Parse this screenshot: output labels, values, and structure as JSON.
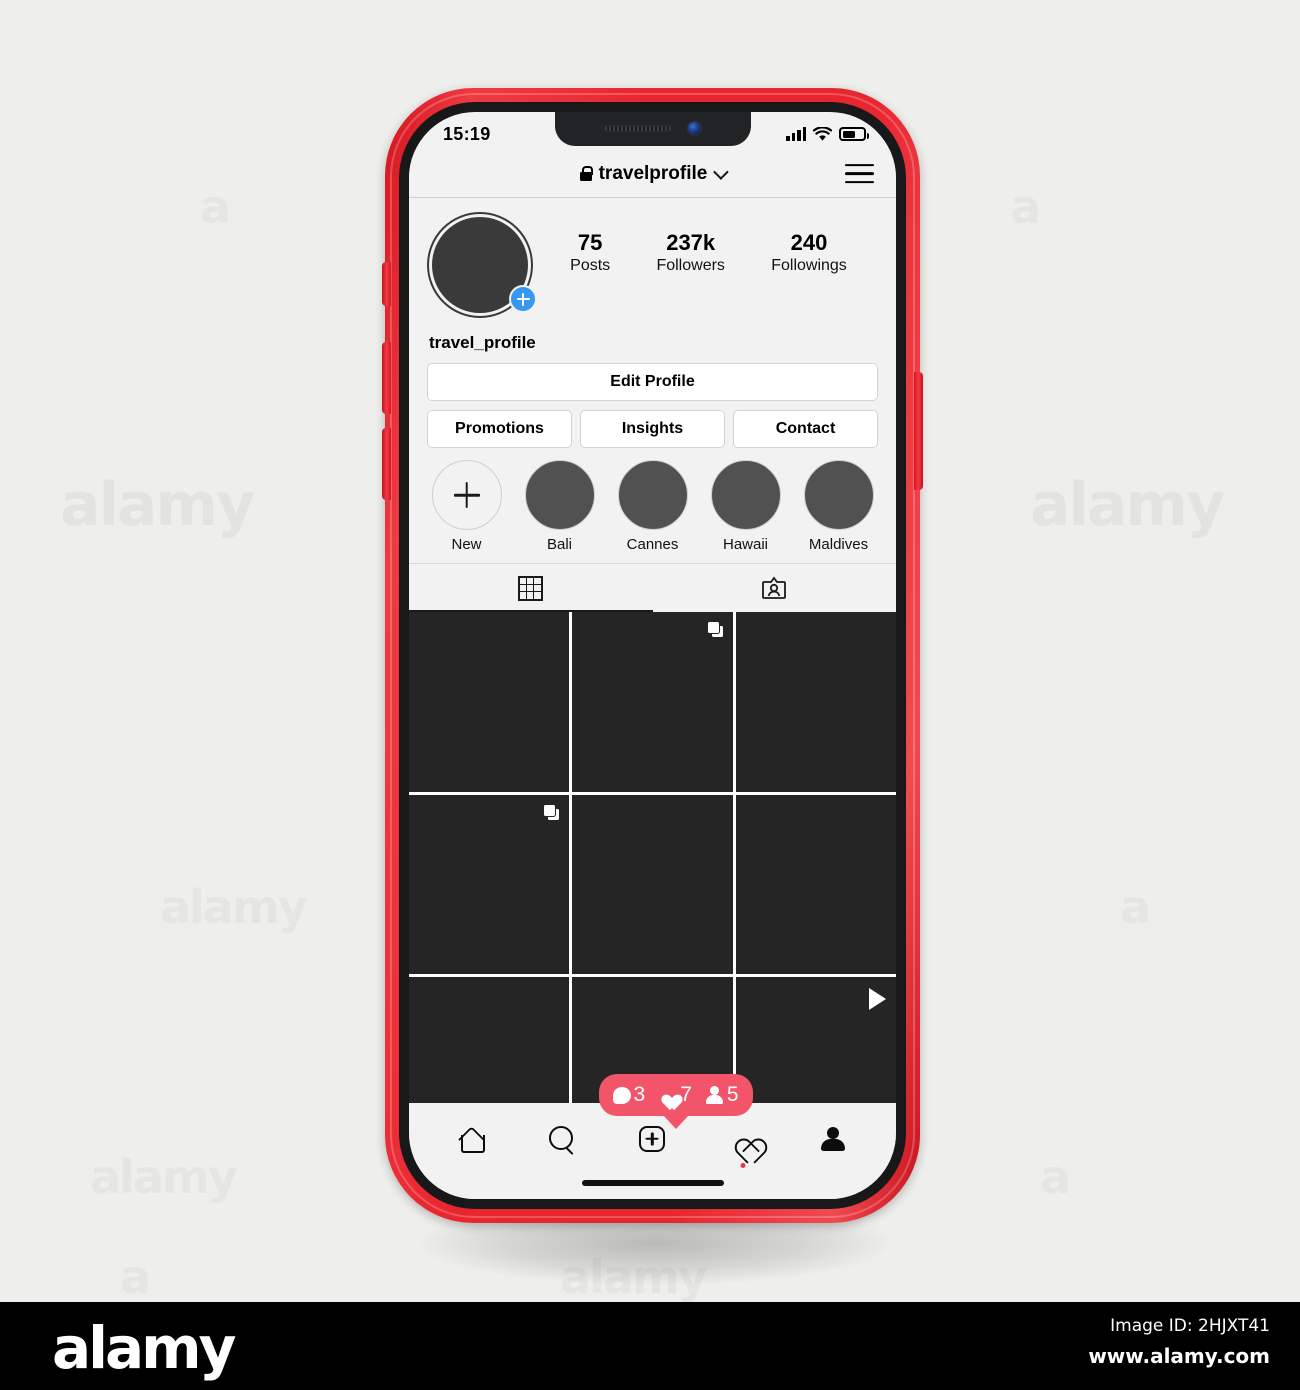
{
  "watermark": {
    "text": "alamy",
    "letter": "a"
  },
  "footer": {
    "logo": "alamy",
    "image_id": "Image ID: 2HJXT41",
    "url": "www.alamy.com"
  },
  "status_bar": {
    "time": "15:19",
    "signal_icon": "signal-bars-icon",
    "wifi_icon": "wifi-icon",
    "battery_icon": "battery-icon",
    "battery_level": "62%"
  },
  "app_bar": {
    "lock_icon": "lock-icon",
    "username": "travelprofile",
    "chevron_icon": "chevron-down-icon",
    "menu_icon": "hamburger-icon"
  },
  "profile": {
    "avatar_icon": "avatar",
    "add_story_icon": "plus-badge-icon",
    "display_name": "travel_profile",
    "stats": [
      {
        "value": "75",
        "label": "Posts"
      },
      {
        "value": "237k",
        "label": "Followers"
      },
      {
        "value": "240",
        "label": "Followings"
      }
    ]
  },
  "actions": {
    "edit_profile": "Edit Profile",
    "secondary": [
      "Promotions",
      "Insights",
      "Contact"
    ]
  },
  "highlights": [
    {
      "label": "New",
      "kind": "new"
    },
    {
      "label": "Bali",
      "kind": "image"
    },
    {
      "label": "Cannes",
      "kind": "image"
    },
    {
      "label": "Hawaii",
      "kind": "image"
    },
    {
      "label": "Maldives",
      "kind": "image"
    }
  ],
  "tabs": [
    {
      "icon": "grid-icon",
      "active": true
    },
    {
      "icon": "tagged-person-icon",
      "active": false
    }
  ],
  "post_grid": {
    "columns": 3,
    "cells": [
      {
        "badge": "none"
      },
      {
        "badge": "carousel"
      },
      {
        "badge": "none"
      },
      {
        "badge": "carousel"
      },
      {
        "badge": "none"
      },
      {
        "badge": "none"
      },
      {
        "badge": "none"
      },
      {
        "badge": "none"
      },
      {
        "badge": "play"
      }
    ]
  },
  "notification_bubble": {
    "items": [
      {
        "icon": "comment-icon",
        "count": "3"
      },
      {
        "icon": "heart-icon",
        "count": "7"
      },
      {
        "icon": "person-icon",
        "count": "5"
      }
    ],
    "color": "#f2556a"
  },
  "bottom_nav": [
    {
      "icon": "home-icon",
      "active": false
    },
    {
      "icon": "search-icon",
      "active": false
    },
    {
      "icon": "add-post-icon",
      "active": false
    },
    {
      "icon": "activity-heart-icon",
      "active": false,
      "has_dot": true
    },
    {
      "icon": "profile-icon",
      "active": true
    }
  ],
  "colors": {
    "frame_red": "#e8262f",
    "screen_bg": "#f2f2f2",
    "post_cell": "#252525",
    "highlight_circle": "#515151",
    "accent_blue": "#3897f0",
    "notif_red": "#f2556a",
    "dot_red": "#e8394f"
  }
}
